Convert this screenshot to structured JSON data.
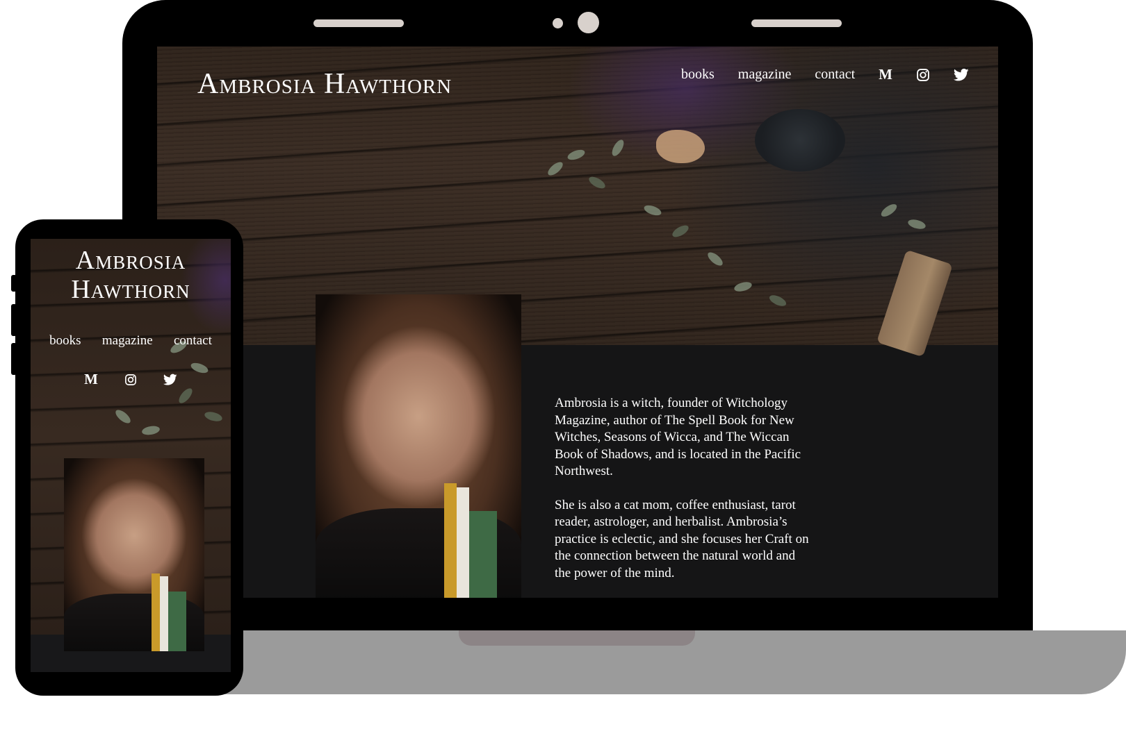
{
  "site": {
    "brand": "Ambrosia Hawthorn",
    "nav": {
      "books": "books",
      "magazine": "magazine",
      "contact": "contact"
    },
    "social": {
      "medium": "M",
      "instagram": "instagram-icon",
      "twitter": "twitter-icon"
    }
  },
  "about": {
    "paragraph1": "Ambrosia is a witch, founder of Witchology Magazine, author of The Spell Book for New Witches, Seasons of Wicca, and The Wiccan Book of Shadows, and is located in the Pacific Northwest.",
    "paragraph2": "She is also a cat mom, coffee enthusiast, tarot reader, astrologer, and herbalist. Ambrosia’s practice is eclectic, and she focuses her Craft on the connection between the natural world and the power of the mind."
  },
  "colors": {
    "page_background": "#ffffff",
    "device_frame": "#000000",
    "laptop_base": "#9b9b9b",
    "site_dark": "#151516",
    "text": "#ffffff"
  }
}
